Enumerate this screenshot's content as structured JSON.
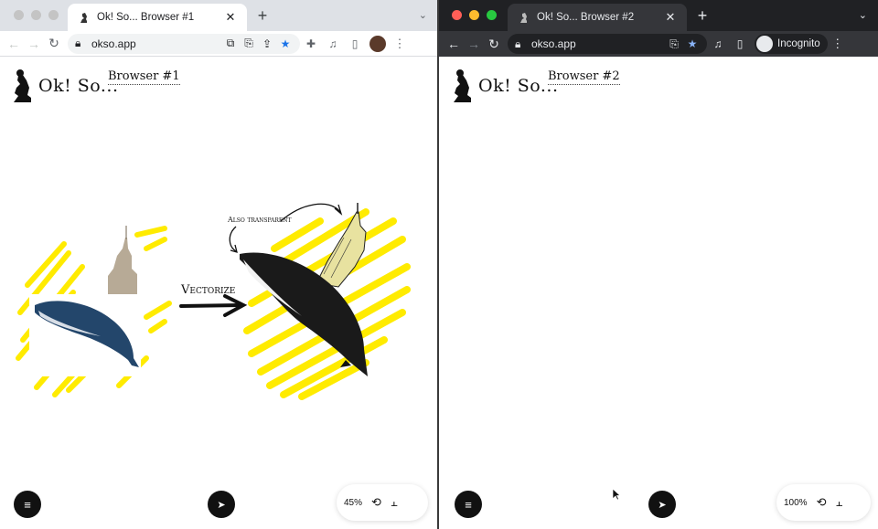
{
  "left_browser": {
    "tab_title": "Ok! So... Browser #1",
    "url": "okso.app",
    "board": {
      "logo_text": "Ok! So...",
      "name": "Browser #1",
      "annotation_vectorize": "Vectorize",
      "annotation_transparent": "Also transparent",
      "zoom": "45%"
    }
  },
  "right_browser": {
    "tab_title": "Ok! So... Browser #2",
    "url": "okso.app",
    "incognito_label": "Incognito",
    "board": {
      "logo_text": "Ok! So...",
      "name": "Browser #2",
      "zoom": "100%"
    }
  },
  "colors": {
    "scribble_yellow": "#ffeb00",
    "fab_black": "#111111",
    "bookmark_star": "#1a73e8"
  },
  "icons": {
    "menu": "hamburger-icon",
    "navigate": "send-arrow-icon",
    "history": "history-icon",
    "font": "text-style-icon"
  }
}
